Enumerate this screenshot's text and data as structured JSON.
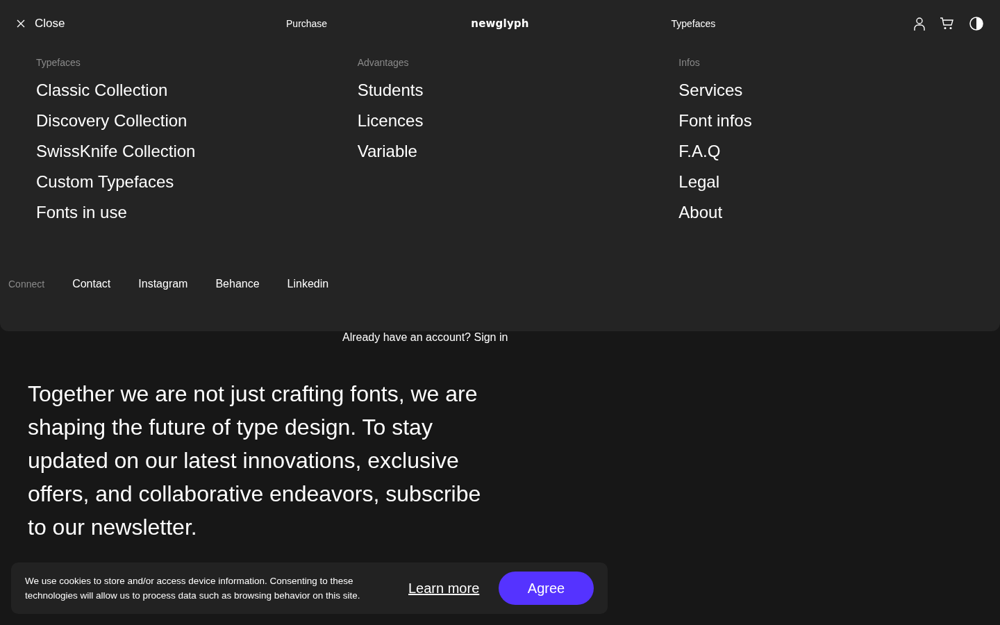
{
  "top_bar": {
    "close": {
      "label": "Close"
    },
    "nav": [
      "Purchase",
      "Typefaces"
    ],
    "logo": "newglyph"
  },
  "menu": {
    "columns": [
      {
        "heading": "Typefaces",
        "items": [
          "Classic Collection",
          "Discovery Collection",
          "SwissKnife Collection",
          "Custom Typefaces",
          "Fonts in use"
        ]
      },
      {
        "heading": "Advantages",
        "items": [
          "Students",
          "Licences",
          "Variable"
        ]
      },
      {
        "heading": "Infos",
        "items": [
          "Services",
          "Font infos",
          "F.A.Q",
          "Legal",
          "About"
        ]
      }
    ],
    "connect": {
      "label": "Connect",
      "links": [
        "Contact",
        "Instagram",
        "Behance",
        "Linkedin"
      ]
    }
  },
  "account_prompt": "Already have an account? Sign in",
  "newsletter_text": "Together we are not just crafting fonts, we are shaping the future of type design. To stay updated on our latest innovations, exclusive offers, and collaborative endeavors, subscribe to our newsletter.",
  "cookie_banner": {
    "message": "We use cookies to store and/or access device information. Consenting to these technologies will allow us to process data such as browsing behavior on this site.",
    "learn_more": "Learn more",
    "agree": "Agree"
  }
}
